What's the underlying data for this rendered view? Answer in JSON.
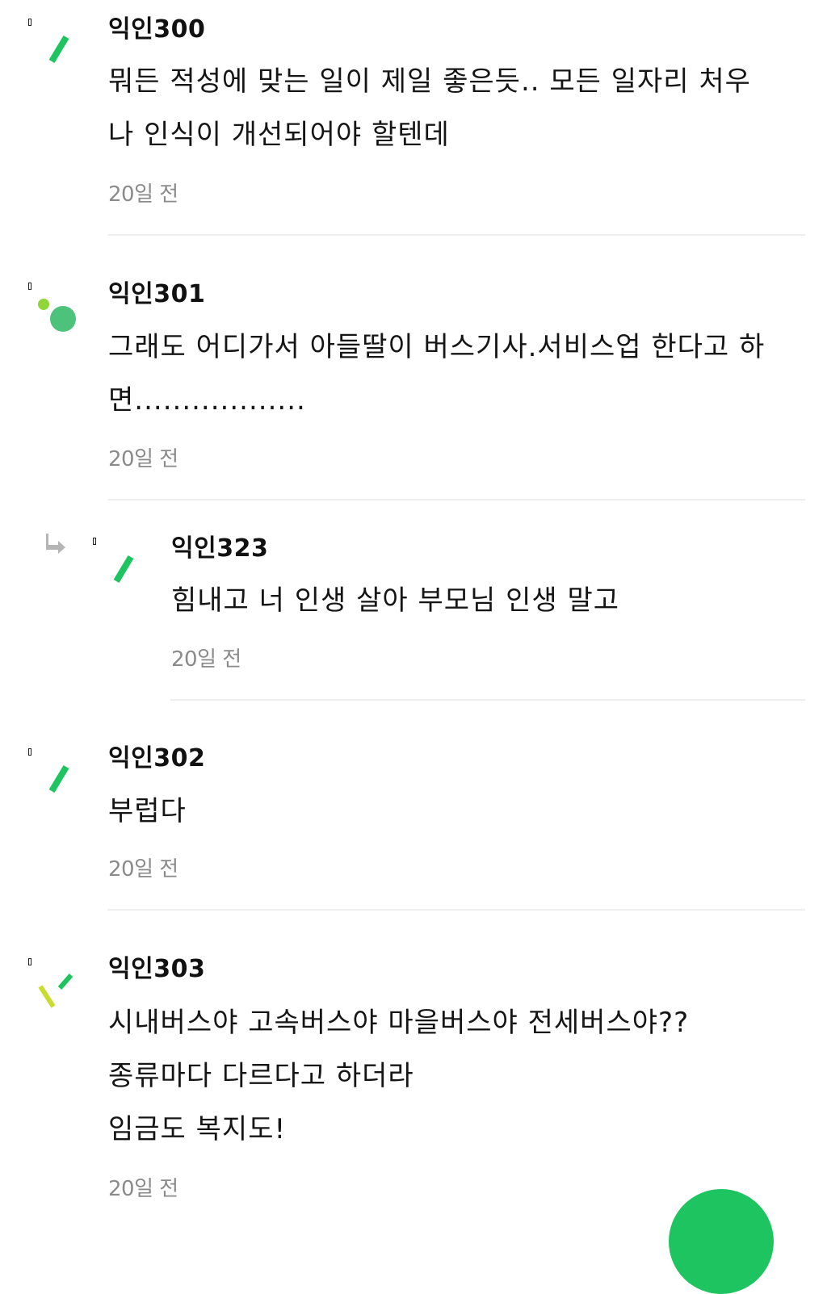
{
  "comments": [
    {
      "author": "익인300",
      "lines": [
        "뭐든 적성에 맞는 일이 제일 좋은듯.. 모든 일자리 처우",
        "나 인식이 개선되어야 할텐데"
      ],
      "time": "20일 전",
      "avatar": "green-slash-icon"
    },
    {
      "author": "익인301",
      "lines": [
        "그래도 어디가서 아들딸이 버스기사.서비스업 한다고 하",
        "면.................."
      ],
      "time": "20일 전",
      "avatar": "green-dots-icon"
    },
    {
      "author": "익인323",
      "lines": [
        "힘내고 너 인생 살아 부모님 인생 말고"
      ],
      "time": "20일 전",
      "avatar": "green-slash-icon",
      "is_reply": true
    },
    {
      "author": "익인302",
      "lines": [
        "부럽다"
      ],
      "time": "20일 전",
      "avatar": "green-slash-icon"
    },
    {
      "author": "익인303",
      "lines": [
        "시내버스야 고속버스야 마을버스야 전세버스야??",
        "종류마다 다르다고 하더라",
        "임금도 복지도!"
      ],
      "time": "20일 전",
      "avatar": "yellow-green-check-icon"
    }
  ],
  "colors": {
    "accent": "#1ec45f",
    "time_gray": "#8a8a8a",
    "divider": "#eeeeee"
  }
}
